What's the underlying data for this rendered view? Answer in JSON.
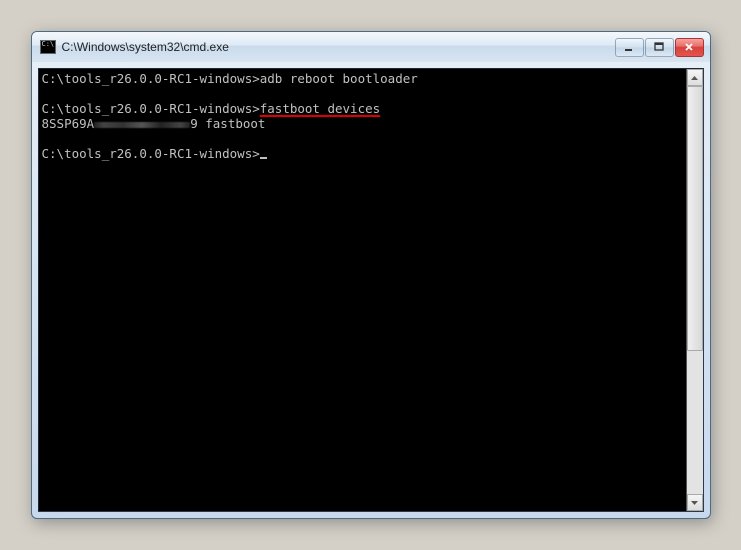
{
  "window": {
    "title": "C:\\Windows\\system32\\cmd.exe"
  },
  "console": {
    "prompt1": "C:\\tools_r26.0.0-RC1-windows>",
    "cmd1": "adb reboot bootloader",
    "prompt2": "C:\\tools_r26.0.0-RC1-windows>",
    "cmd2": "fastboot devices",
    "output_prefix": "8SSP69A",
    "output_suffix_num": "9",
    "output_mode": " fastboot",
    "prompt3": "C:\\tools_r26.0.0-RC1-windows>"
  }
}
